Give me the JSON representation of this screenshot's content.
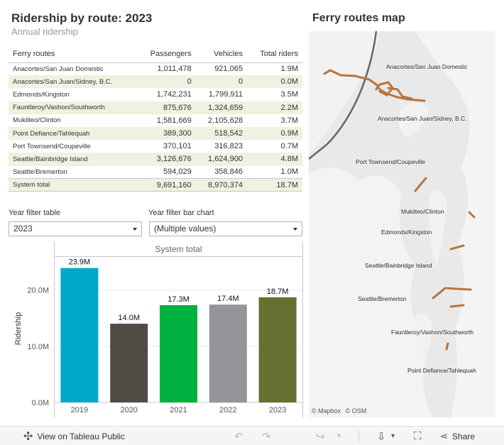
{
  "header": {
    "title": "Ridership by route: 2023",
    "subtitle": "Annual ridership"
  },
  "table": {
    "columns": [
      "Ferry routes",
      "Passengers",
      "Vehicles",
      "Total riders"
    ],
    "rows": [
      {
        "route": "Anacortes/San Juan Domestic",
        "passengers": "1,011,478",
        "vehicles": "921,065",
        "total": "1.9M"
      },
      {
        "route": "Anacortes/San Juan/Sidney, B.C.",
        "passengers": "0",
        "vehicles": "0",
        "total": "0.0M"
      },
      {
        "route": "Edmonds/Kingston",
        "passengers": "1,742,231",
        "vehicles": "1,799,911",
        "total": "3.5M"
      },
      {
        "route": "Fauntleroy/Vashon/Southworth",
        "passengers": "875,676",
        "vehicles": "1,324,659",
        "total": "2.2M"
      },
      {
        "route": "Mukilteo/Clinton",
        "passengers": "1,581,669",
        "vehicles": "2,105,628",
        "total": "3.7M"
      },
      {
        "route": "Point Defiance/Tahlequah",
        "passengers": "389,300",
        "vehicles": "518,542",
        "total": "0.9M"
      },
      {
        "route": "Port Townsend/Coupeville",
        "passengers": "370,101",
        "vehicles": "316,823",
        "total": "0.7M"
      },
      {
        "route": "Seattle/Bainbridge Island",
        "passengers": "3,126,676",
        "vehicles": "1,624,900",
        "total": "4.8M"
      },
      {
        "route": "Seattle/Bremerton",
        "passengers": "594,029",
        "vehicles": "358,846",
        "total": "1.0M"
      },
      {
        "route": "System total",
        "passengers": "9,691,160",
        "vehicles": "8,970,374",
        "total": "18.7M"
      }
    ]
  },
  "filters": {
    "table": {
      "label": "Year filter table",
      "value": "2023"
    },
    "chart": {
      "label": "Year filter bar chart",
      "value": "(Multiple values)"
    }
  },
  "chart_data": {
    "type": "bar",
    "title": "System total",
    "xlabel": "",
    "ylabel": "Ridership",
    "categories": [
      "2019",
      "2020",
      "2021",
      "2022",
      "2023"
    ],
    "values": [
      23.9,
      14.0,
      17.3,
      17.4,
      18.7
    ],
    "value_labels": [
      "23.9M",
      "14.0M",
      "17.3M",
      "17.4M",
      "18.7M"
    ],
    "colors": [
      "#00a9c9",
      "#4f4b45",
      "#00b140",
      "#939598",
      "#667030"
    ],
    "y_ticks": [
      0,
      10,
      20
    ],
    "y_tick_labels": [
      "0.0M",
      "10.0M",
      "20.0M"
    ],
    "ylim": [
      0,
      25
    ],
    "unit": "M"
  },
  "map": {
    "title": "Ferry routes map",
    "route_color": "#b8743c",
    "labels": [
      "Anacortes/San Juan Domestic",
      "Anacortes/San Juan/Sidney, B.C.",
      "Port Townsend/Coupeville",
      "Mukilteo/Clinton",
      "Edmonds/Kingston",
      "Seattle/Bainbridge Island",
      "Seattle/Bremerton",
      "Fauntleroy/Vashon/Southworth",
      "Point Defiance/Tahlequah"
    ],
    "credit_mapbox": "© Mapbox",
    "credit_osm": "© OSM"
  },
  "toolbar": {
    "view_label": "View on Tableau Public",
    "share_label": "Share"
  }
}
